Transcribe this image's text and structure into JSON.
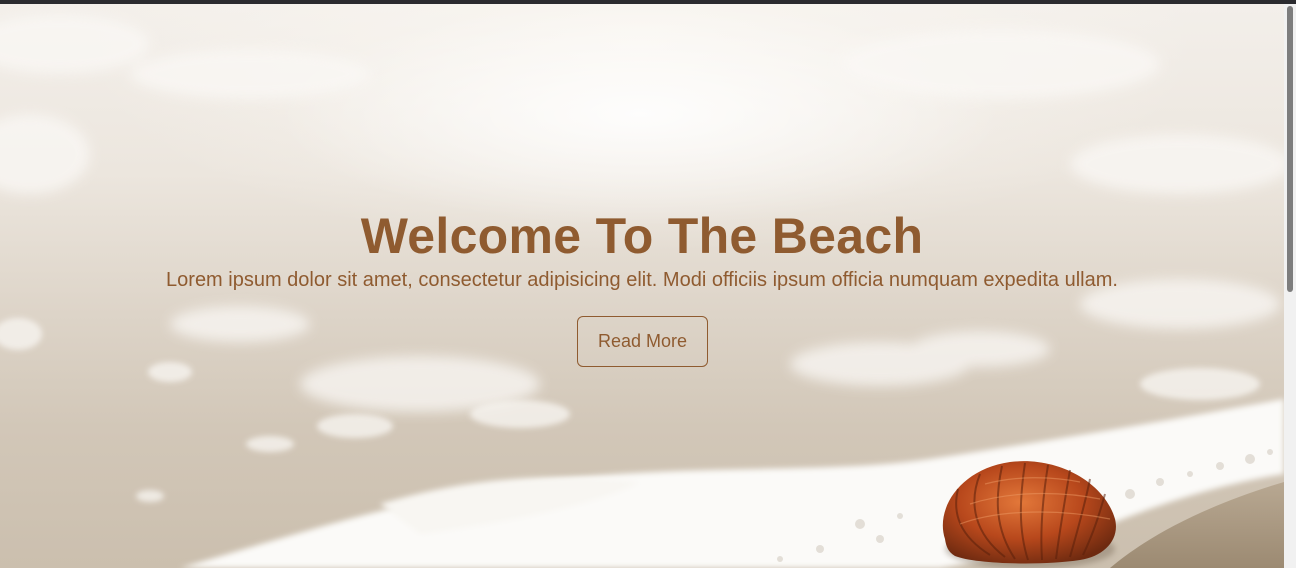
{
  "hero": {
    "title": "Welcome To The Beach",
    "subtitle": "Lorem ipsum dolor sit amet, consectetur adipisicing elit. Modi officiis ipsum officia numquam expedita ullam.",
    "button_label": "Read More"
  },
  "colors": {
    "accent": "#8f5b30",
    "top_bar": "#2b2b2f",
    "scroll_thumb": "#7d7d7d"
  },
  "background_image": {
    "icon": "seashell-icon"
  }
}
